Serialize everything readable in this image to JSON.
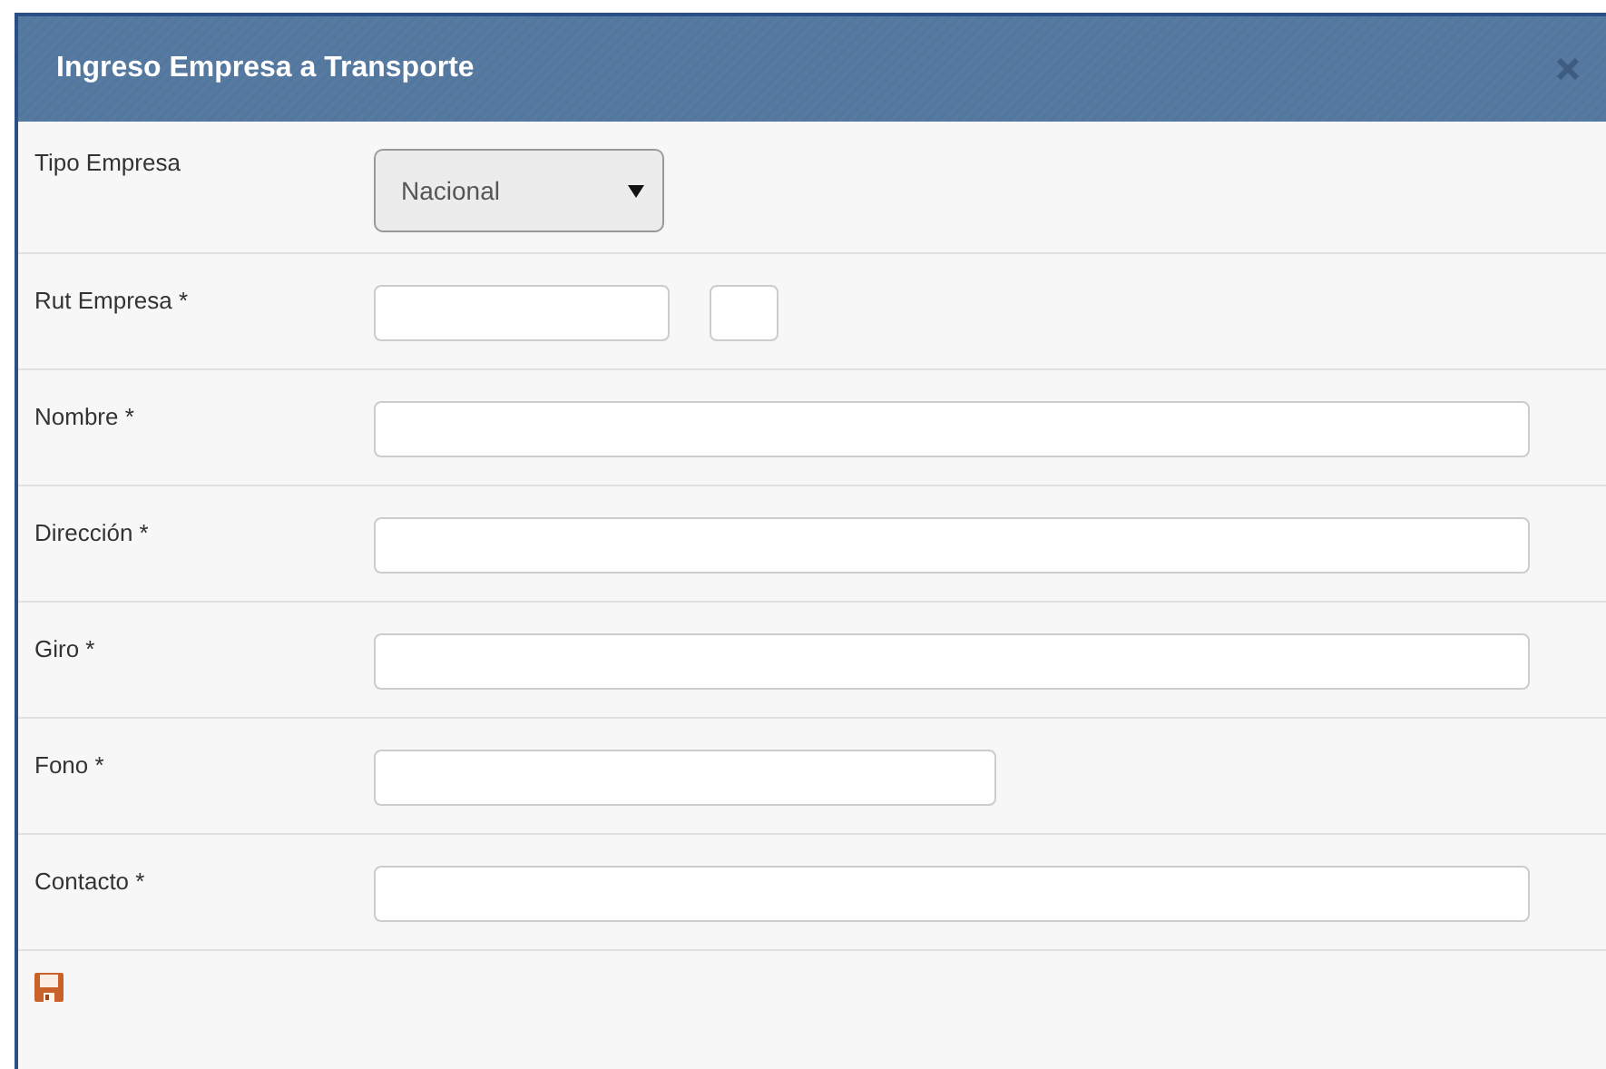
{
  "dialog": {
    "title": "Ingreso Empresa a Transporte"
  },
  "fields": [
    {
      "label": "Tipo Empresa",
      "kind": "select",
      "value": "Nacional"
    },
    {
      "label": "Rut Empresa *",
      "kind": "rut"
    },
    {
      "label": "Nombre *",
      "kind": "wide"
    },
    {
      "label": "Dirección *",
      "kind": "wide"
    },
    {
      "label": "Giro *",
      "kind": "wide"
    },
    {
      "label": "Fono *",
      "kind": "short"
    },
    {
      "label": "Contacto *",
      "kind": "wide"
    }
  ]
}
